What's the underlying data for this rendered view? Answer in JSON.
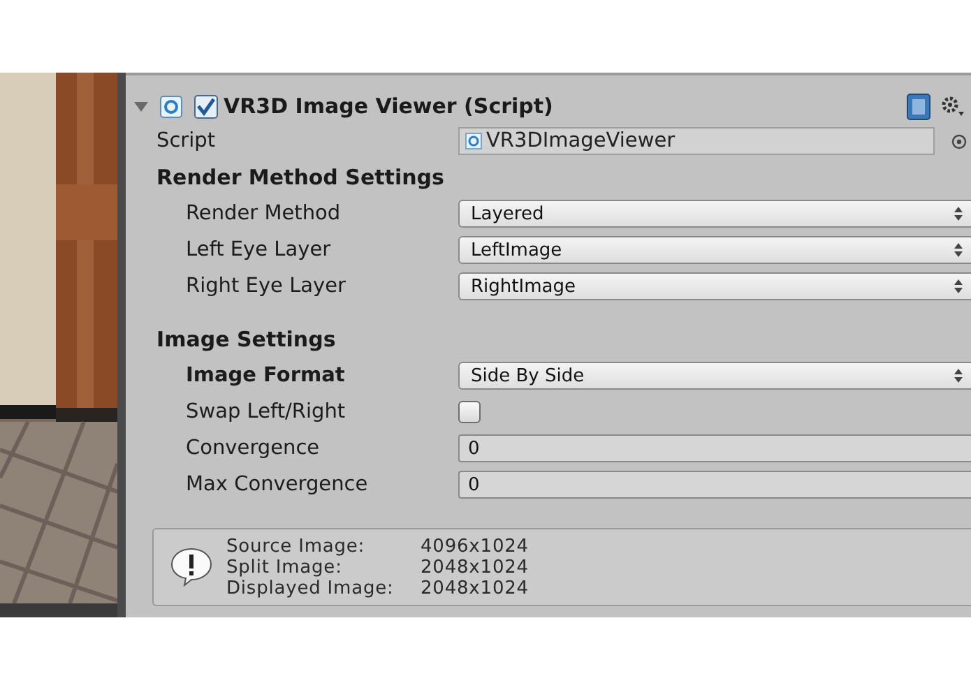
{
  "component": {
    "title": "VR3D Image Viewer (Script)",
    "expanded": true,
    "enabled": true
  },
  "script_field": {
    "label": "Script",
    "value": "VR3DImageViewer"
  },
  "sections": [
    {
      "heading": "Render Method Settings",
      "fields": [
        {
          "kind": "dropdown",
          "label": "Render Method",
          "value": "Layered",
          "overridden": false
        },
        {
          "kind": "dropdown",
          "label": "Left Eye Layer",
          "value": "LeftImage",
          "overridden": false
        },
        {
          "kind": "dropdown",
          "label": "Right Eye Layer",
          "value": "RightImage",
          "overridden": false
        }
      ]
    },
    {
      "heading": "Image Settings",
      "fields": [
        {
          "kind": "dropdown",
          "label": "Image Format",
          "value": "Side By Side",
          "overridden": true
        },
        {
          "kind": "checkbox",
          "label": "Swap Left/Right",
          "checked": false,
          "overridden": false
        },
        {
          "kind": "number",
          "label": "Convergence",
          "value": "0",
          "overridden": false
        },
        {
          "kind": "number",
          "label": "Max Convergence",
          "value": "0",
          "overridden": false
        }
      ]
    }
  ],
  "info_box": {
    "lines": [
      {
        "label": "Source Image:",
        "value": "4096x1024"
      },
      {
        "label": "Split Image:",
        "value": "2048x1024"
      },
      {
        "label": "Displayed Image:",
        "value": "2048x1024"
      }
    ]
  }
}
